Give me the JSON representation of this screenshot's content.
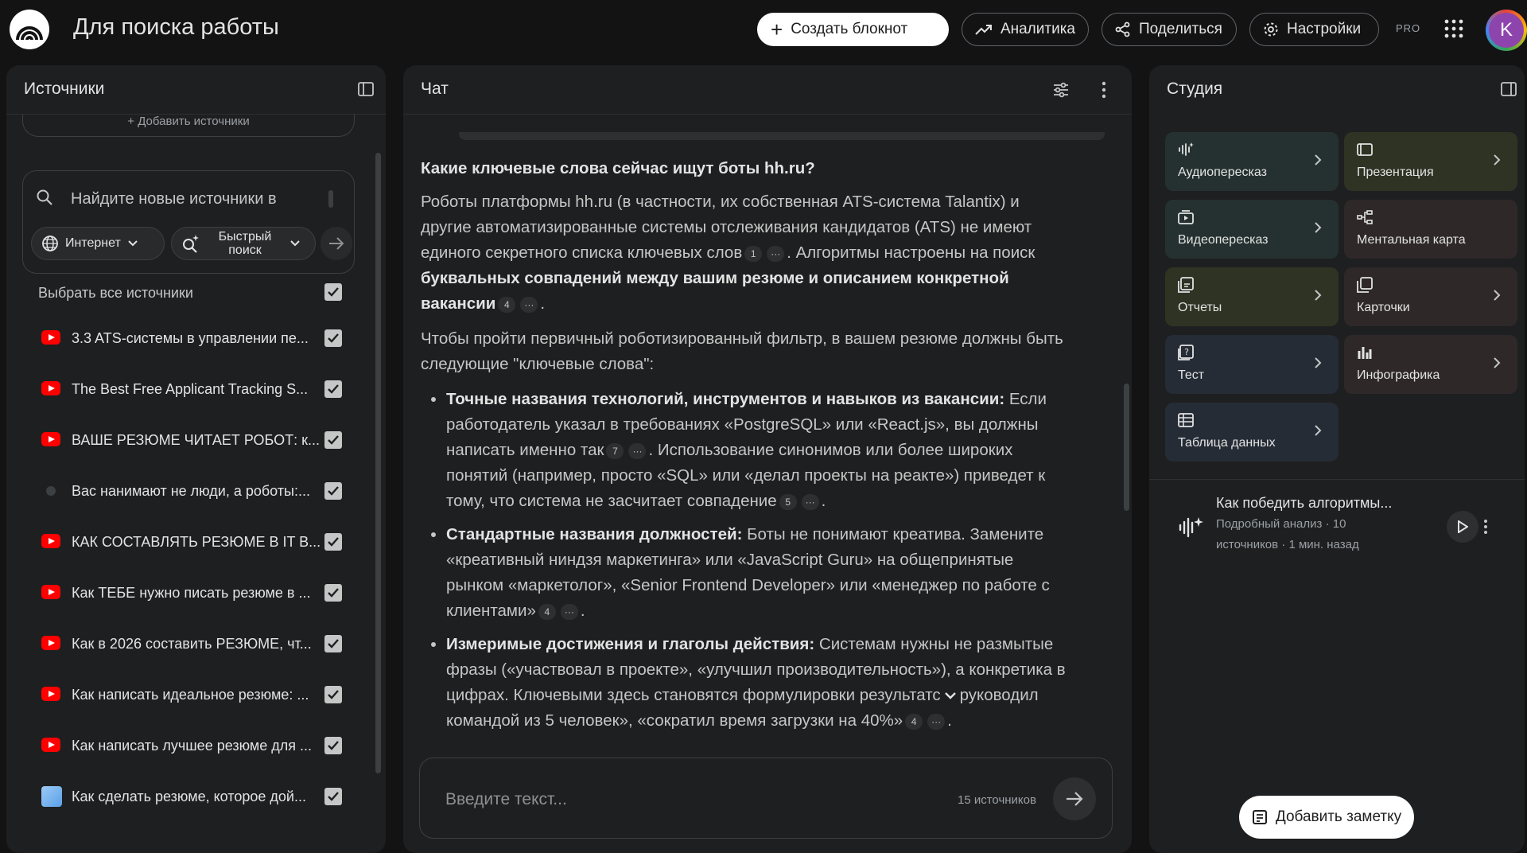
{
  "header": {
    "title": "Для поиска работы",
    "create_label": "Создать блокнот",
    "analytics_label": "Аналитика",
    "share_label": "Поделиться",
    "settings_label": "Настройки",
    "pro_label": "PRO",
    "avatar_letter": "K"
  },
  "sources": {
    "title": "Источники",
    "add_label": "+ Добавить источники",
    "search_placeholder": "Найдите новые источники в",
    "chip_web": "Интернет",
    "chip_fast_1": "Быстрый",
    "chip_fast_2": "поиск",
    "select_all": "Выбрать все источники",
    "items": [
      {
        "label": "3.3 ATS-системы в управлении пе...",
        "icon": "youtube-icon"
      },
      {
        "label": "The Best Free Applicant Tracking S...",
        "icon": "youtube-icon"
      },
      {
        "label": "ВАШЕ РЕЗЮМЕ ЧИТАЕТ РОБОТ: к...",
        "icon": "youtube-icon"
      },
      {
        "label": "Вас нанимают не люди, а роботы:...",
        "icon": "web-icon"
      },
      {
        "label": "КАК СОСТАВЛЯТЬ РЕЗЮМЕ В IT В...",
        "icon": "youtube-icon"
      },
      {
        "label": "Как ТЕБЕ нужно писать резюме в ...",
        "icon": "youtube-icon"
      },
      {
        "label": "Как в 2026 составить РЕЗЮМЕ, чт...",
        "icon": "youtube-icon"
      },
      {
        "label": "Как написать идеальное резюме: ...",
        "icon": "youtube-icon"
      },
      {
        "label": "Как написать лучшее резюме для ...",
        "icon": "youtube-icon"
      },
      {
        "label": "Как сделать резюме, которое дой...",
        "icon": "web-icon"
      }
    ]
  },
  "chat": {
    "title": "Чат",
    "question": "Какие ключевые слова сейчас ищут боты hh.ru?",
    "p1_a": "Роботы платформы hh.ru (в частности, их собственная ATS-система Talantix) и другие автоматизированные системы отслеживания кандидатов (ATS) не имеют единого секретного списка ключевых слов",
    "p1_c1": "1",
    "p1_b": ". Алгоритмы настроены на поиск ",
    "p1_bold": "буквальных совпадений между вашим резюме и описанием конкретной вакансии",
    "p1_c2": "4",
    "p2": "Чтобы пройти первичный роботизированный фильтр, в вашем резюме должны быть следующие \"ключевые слова\":",
    "b1_title": "Точные названия технологий, инструментов и навыков из вакансии:",
    "b1_a": " Если работодатель указал в требованиях «PostgreSQL» или «React.js», вы должны написать именно так",
    "b1_c1": "7",
    "b1_b": ". Использование синонимов или более широких понятий (например, просто «SQL» или «делал проекты на реакте») приведет к тому, что система не засчитает совпадение",
    "b1_c2": "5",
    "b2_title": "Стандартные названия должностей:",
    "b2_a": " Боты не понимают креатива. Замените «креативный ниндзя маркетинга» или «JavaScript Guru» на общепринятые рынком «маркетолог», «Senior Frontend Developer» или «менеджер по работе с клиентами»",
    "b2_c1": "4",
    "b3_title": "Измеримые достижения и глаголы действия:",
    "b3_a": " Системам нужны не размытые фразы («участвовал в проекте», «улучшил производительность»), а конкретика в цифрах. Ключевыми здесь становятся формулировки результатс",
    "b3_b": "руководил командой из 5 человек», «сократил время загрузки на 40%»",
    "b3_c1": "4",
    "more": "···",
    "input_placeholder": "Введите текст...",
    "source_count": "15 источников"
  },
  "studio": {
    "title": "Студия",
    "tiles": [
      {
        "label": "Аудиопересказ",
        "color": "#253130"
      },
      {
        "label": "Презентация",
        "color": "#2f3324"
      },
      {
        "label": "Видеопересказ",
        "color": "#253130"
      },
      {
        "label": "Ментальная карта",
        "color": "#2e2829"
      },
      {
        "label": "Отчеты",
        "color": "#2f3324"
      },
      {
        "label": "Карточки",
        "color": "#2e2829"
      },
      {
        "label": "Тест",
        "color": "#252c36"
      },
      {
        "label": "Инфографика",
        "color": "#2e2829"
      },
      {
        "label": "Таблица данных",
        "color": "#252c36"
      }
    ],
    "note_title": "Как победить алгоритмы...",
    "note_meta_1": "Подробный анализ · 10",
    "note_meta_2": "источников · 1 мин. назад",
    "add_note_label": "Добавить заметку"
  }
}
